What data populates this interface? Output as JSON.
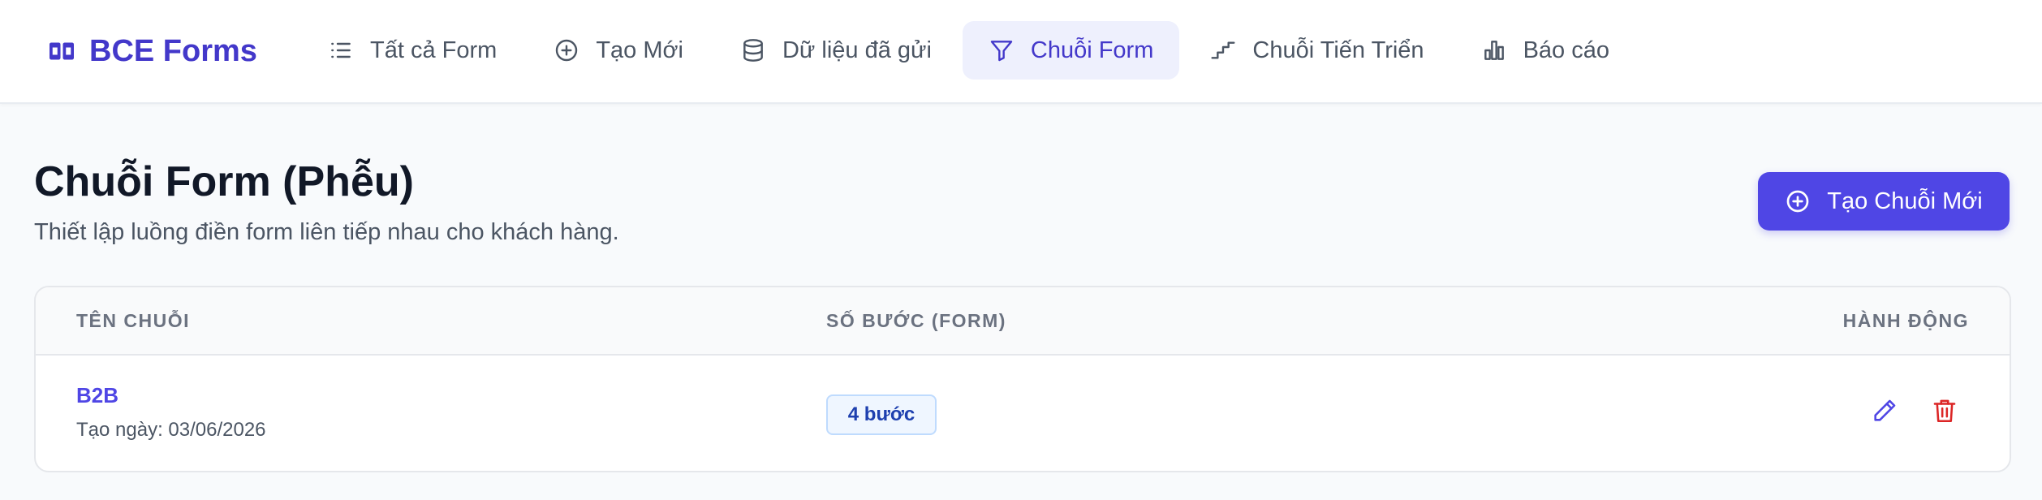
{
  "brand": {
    "name": "BCE Forms",
    "icon": "logo-icon"
  },
  "nav": {
    "items": [
      {
        "label": "Tất cả Form",
        "icon": "list-icon"
      },
      {
        "label": "Tạo Mới",
        "icon": "plus-circle-icon"
      },
      {
        "label": "Dữ liệu đã gửi",
        "icon": "database-icon"
      },
      {
        "label": "Chuỗi Form",
        "icon": "filter-icon",
        "active": true
      },
      {
        "label": "Chuỗi Tiến Triển",
        "icon": "stairs-icon"
      },
      {
        "label": "Báo cáo",
        "icon": "bar-chart-icon"
      }
    ]
  },
  "page": {
    "title": "Chuỗi Form (Phễu)",
    "subtitle": "Thiết lập luồng điền form liên tiếp nhau cho khách hàng.",
    "create_button": "Tạo Chuỗi Mới"
  },
  "table": {
    "headers": [
      "TÊN CHUỖI",
      "SỐ BƯỚC (FORM)",
      "HÀNH ĐỘNG"
    ],
    "rows": [
      {
        "name": "B2B",
        "created": "Tạo ngày: 03/06/2026",
        "steps": "4 bước"
      }
    ]
  },
  "colors": {
    "accent": "#4f46e5",
    "brand": "#4338ca",
    "danger": "#dc2626"
  }
}
